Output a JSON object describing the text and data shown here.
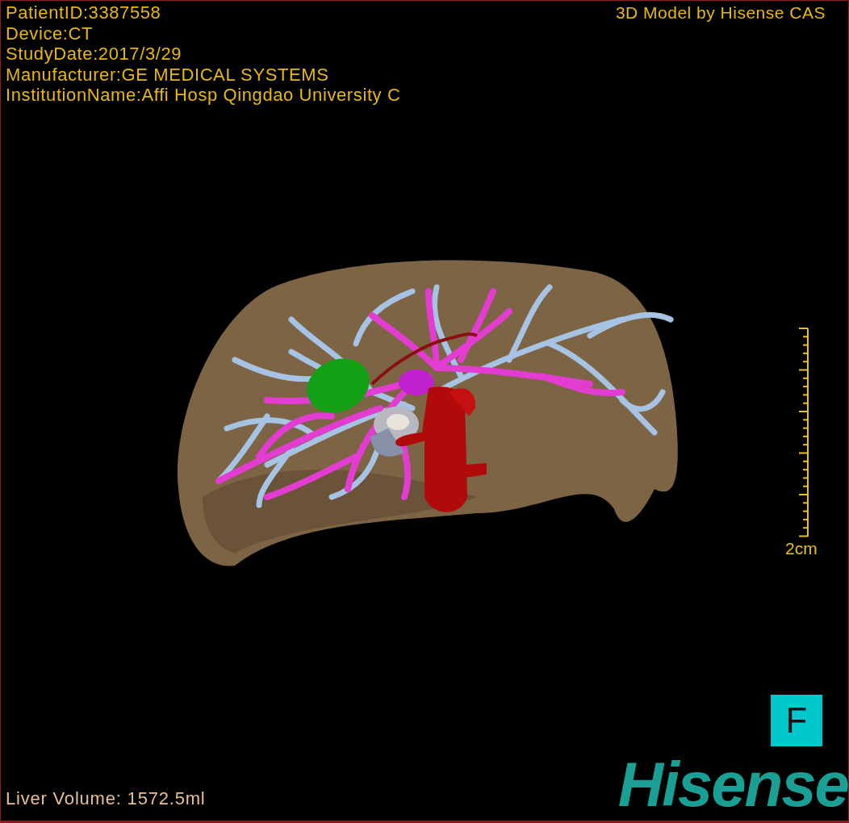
{
  "info_lines": [
    "PatientID:3387558",
    "Device:CT",
    "StudyDate:2017/3/29",
    "Manufacturer:GE MEDICAL SYSTEMS",
    "InstitutionName:Affi Hosp Qingdao University C"
  ],
  "credit": "3D Model by Hisense CAS",
  "scale": {
    "label": "2cm"
  },
  "orientation": {
    "label": "F"
  },
  "liver_volume": "Liver Volume: 1572.5ml",
  "logo": "Hisense"
}
